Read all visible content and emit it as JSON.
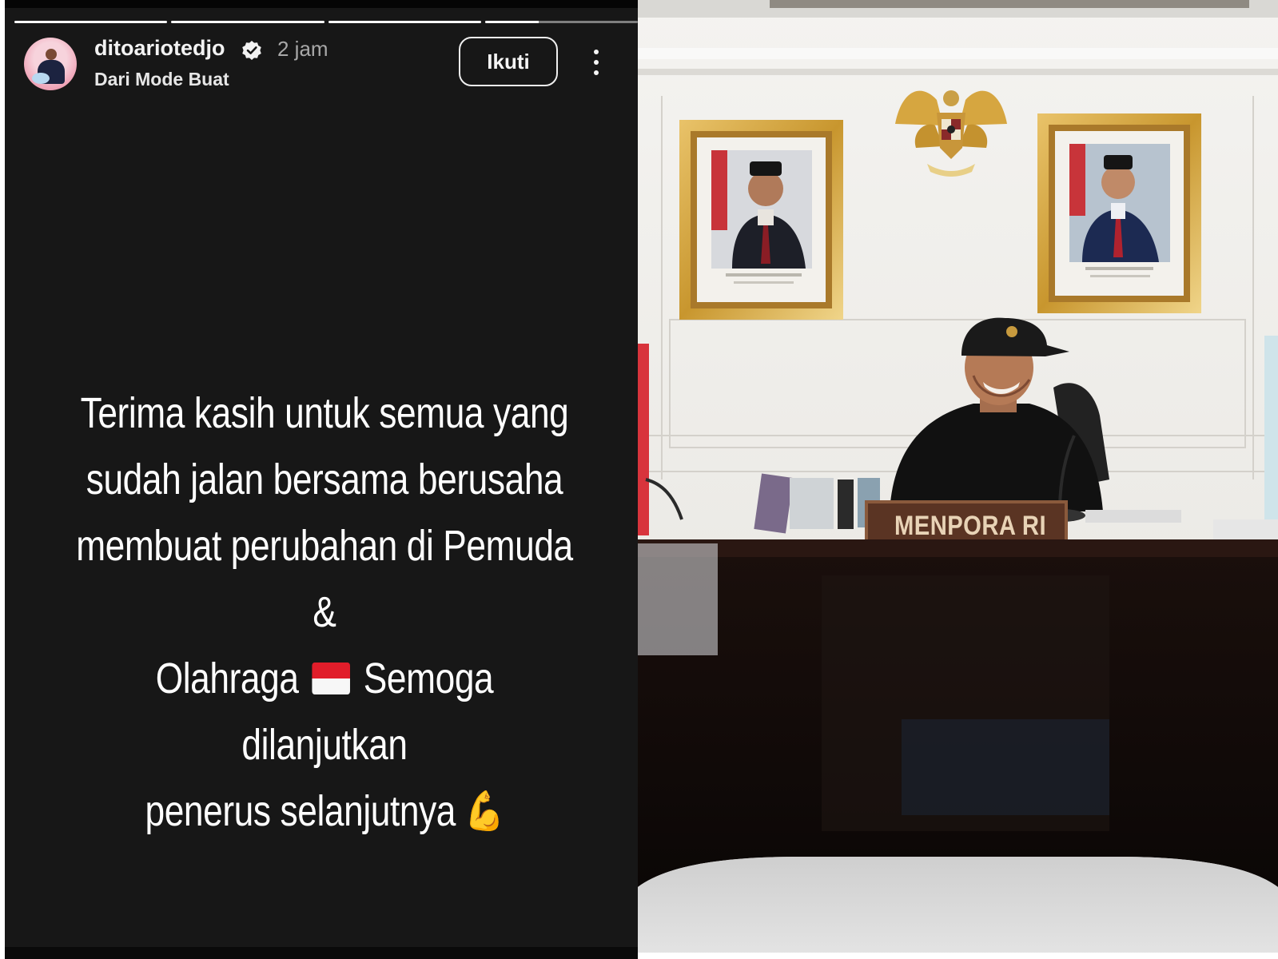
{
  "story": {
    "progress": [
      1,
      1,
      1,
      0.35
    ],
    "author": {
      "username": "ditoariotedjo",
      "verified": true,
      "time_ago": "2 jam",
      "subtitle": "Dari Mode Buat"
    },
    "follow_label": "Ikuti",
    "caption": {
      "line1": "Terima kasih untuk semua yang",
      "line2": "sudah jalan bersama berusaha",
      "line3": "membuat perubahan di  Pemuda &",
      "line4_a": "Olahraga",
      "line4_b": "Semoga dilanjutkan",
      "line5": "penerus selanjutnya",
      "emoji_end": "💪"
    },
    "colors": {
      "background": "#171717",
      "text": "#ffffff",
      "flag_red": "#e11d2a"
    },
    "icons": [
      "verified-icon",
      "more-options-icon",
      "indonesia-flag-icon",
      "flexed-biceps-icon"
    ]
  },
  "photo": {
    "nameplate": "MENPORA RI"
  }
}
